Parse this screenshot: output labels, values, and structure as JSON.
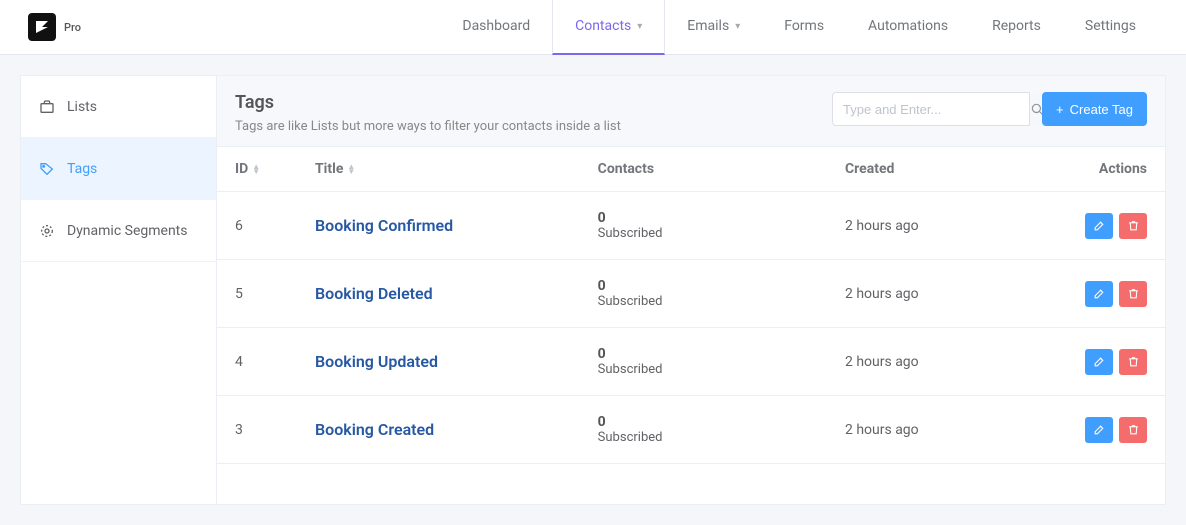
{
  "brand": {
    "pro_label": "Pro"
  },
  "topnav": [
    {
      "label": "Dashboard",
      "dropdown": false,
      "active": false
    },
    {
      "label": "Contacts",
      "dropdown": true,
      "active": true
    },
    {
      "label": "Emails",
      "dropdown": true,
      "active": false
    },
    {
      "label": "Forms",
      "dropdown": false,
      "active": false
    },
    {
      "label": "Automations",
      "dropdown": false,
      "active": false
    },
    {
      "label": "Reports",
      "dropdown": false,
      "active": false
    },
    {
      "label": "Settings",
      "dropdown": false,
      "active": false
    }
  ],
  "sidebar": {
    "lists": "Lists",
    "tags": "Tags",
    "segments": "Dynamic Segments"
  },
  "page": {
    "title": "Tags",
    "subtitle": "Tags are like Lists but more ways to filter your contacts inside a list",
    "search_placeholder": "Type and Enter...",
    "create_label": "Create Tag"
  },
  "columns": {
    "id": "ID",
    "title": "Title",
    "contacts": "Contacts",
    "created": "Created",
    "actions": "Actions"
  },
  "rows": [
    {
      "id": "6",
      "title": "Booking Confirmed",
      "count": "0",
      "status": "Subscribed",
      "created": "2 hours ago"
    },
    {
      "id": "5",
      "title": "Booking Deleted",
      "count": "0",
      "status": "Subscribed",
      "created": "2 hours ago"
    },
    {
      "id": "4",
      "title": "Booking Updated",
      "count": "0",
      "status": "Subscribed",
      "created": "2 hours ago"
    },
    {
      "id": "3",
      "title": "Booking Created",
      "count": "0",
      "status": "Subscribed",
      "created": "2 hours ago"
    }
  ]
}
